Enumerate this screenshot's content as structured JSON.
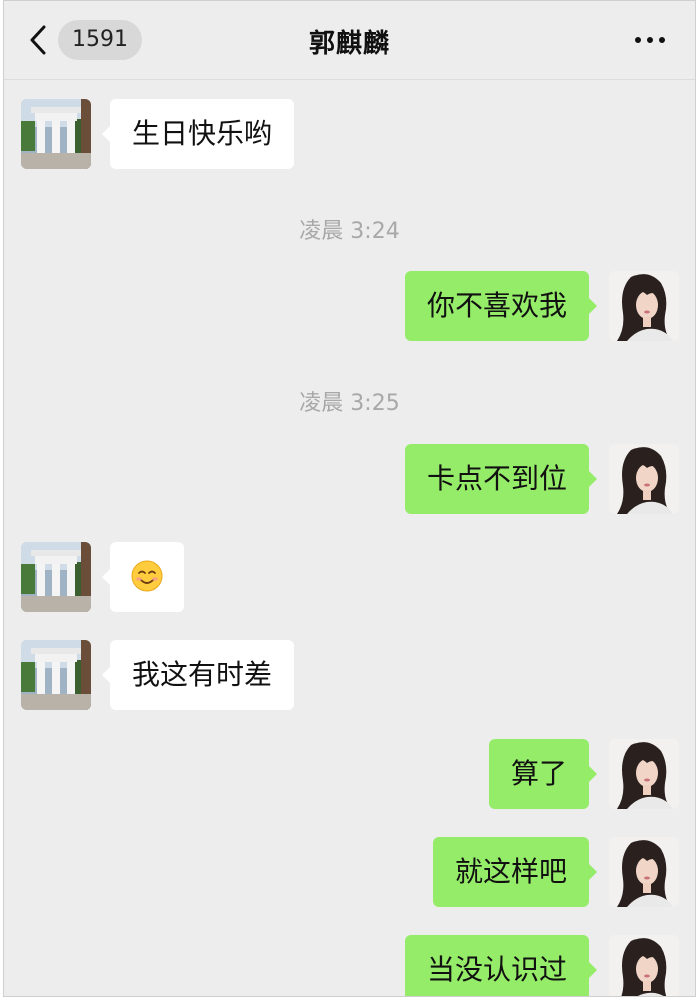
{
  "header": {
    "unread_count": "1591",
    "title": "郭麒麟"
  },
  "messages": [
    {
      "side": "in",
      "text": "生日快乐哟"
    },
    {
      "timestamp": "凌晨 3:24"
    },
    {
      "side": "out",
      "text": "你不喜欢我"
    },
    {
      "timestamp": "凌晨 3:25"
    },
    {
      "side": "out",
      "text": "卡点不到位"
    },
    {
      "side": "in",
      "emoji": "smiling-face-emoji"
    },
    {
      "side": "in",
      "text": "我这有时差"
    },
    {
      "side": "out",
      "text": "算了"
    },
    {
      "side": "out",
      "text": "就这样吧"
    },
    {
      "side": "out",
      "text": "当没认识过"
    }
  ],
  "colors": {
    "background": "#ededed",
    "outgoing_bubble": "#95ec69",
    "incoming_bubble": "#ffffff",
    "timestamp_text": "#a8a8a8"
  },
  "icons": {
    "back": "chevron-left-icon",
    "more": "more-dots-icon",
    "sender_avatar": "contact-avatar-arch",
    "self_avatar": "user-avatar-portrait"
  }
}
